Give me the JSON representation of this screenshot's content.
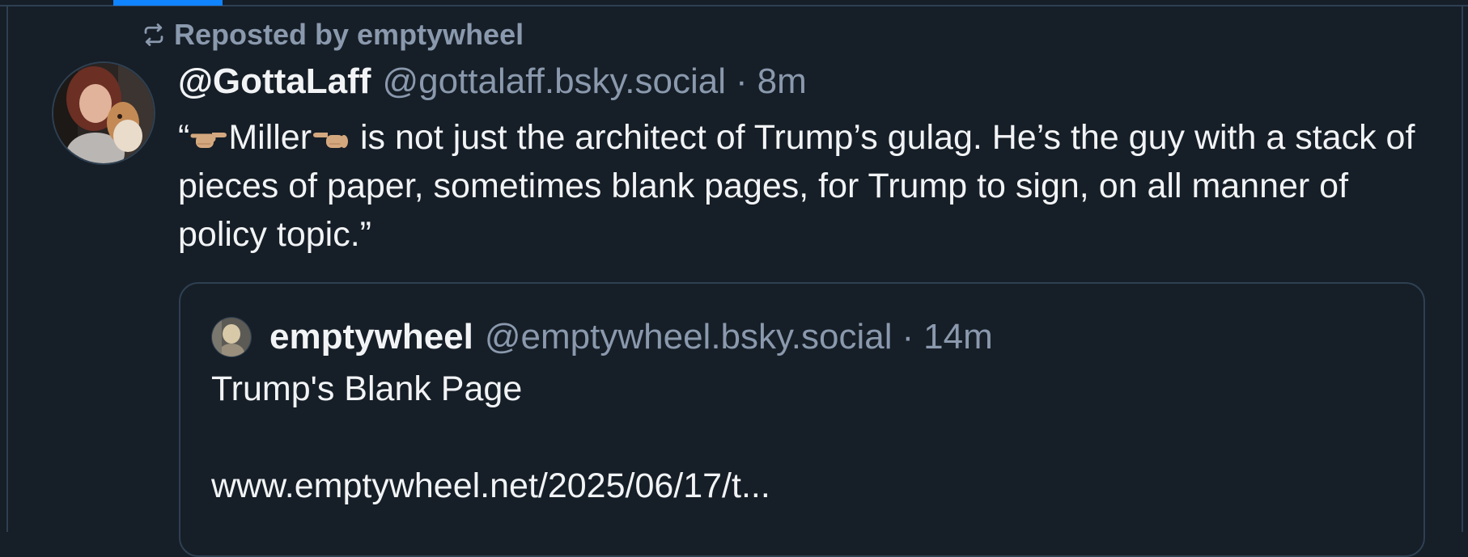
{
  "repost": {
    "icon": "repost-icon",
    "label": "Reposted by emptywheel"
  },
  "post": {
    "author_name": "@GottaLaff",
    "author_handle": "@gottalaff.bsky.social",
    "separator": "·",
    "time": "8m",
    "avatar_icon": "avatar",
    "text_open_quote": "“",
    "text_name": "Miller",
    "text_rest": " is not just the architect of Trump’s gulag. He’s the guy with a stack of pieces of paper, sometimes blank pages, for Trump to sign, on all manner of policy topic.”"
  },
  "quote": {
    "author_name": "emptywheel",
    "author_handle": "@emptywheel.bsky.social",
    "separator": "·",
    "time": "14m",
    "title": "Trump's Blank Page",
    "link": "www.emptywheel.net/2025/06/17/t..."
  },
  "colors": {
    "background": "#161e27",
    "border": "#2e4052",
    "muted_text": "#8a99ad",
    "accent": "#1083fe"
  }
}
